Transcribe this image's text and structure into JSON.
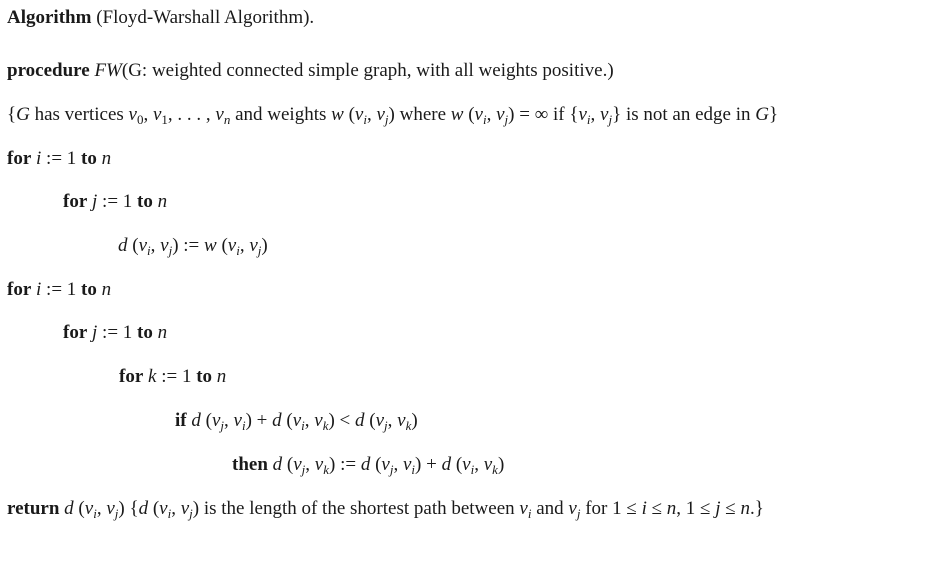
{
  "title": {
    "label": "Algorithm",
    "name": "(Floyd-Warshall Algorithm)."
  },
  "procedure": {
    "keyword": "procedure",
    "name": "FW",
    "params": "(G: weighted connected simple graph, with all weights positive.)"
  },
  "comment_vertices": {
    "open": "{",
    "G": "G",
    "t1": " has vertices ",
    "v": "v",
    "s0": "0",
    "s1": "1",
    "ellipsis": ", . . . , ",
    "sn": "n",
    "t2": " and weights ",
    "w": "w",
    "t3": " where ",
    "infty": " = ∞ if ",
    "t4": " is not an edge in ",
    "close": "}"
  },
  "lines": {
    "for_i_1": {
      "kw": "for",
      "var": "i",
      "assign": " := 1 ",
      "to": "to",
      "end": "n"
    },
    "for_j_1": {
      "kw": "for",
      "var": "j",
      "assign": " := 1 ",
      "to": "to",
      "end": "n"
    },
    "init": {
      "lhs": "d (v",
      "lhs_i": "i",
      "comma": ", v",
      "lhs_j": "j",
      "rp": ")",
      "assign": " := ",
      "rhs": "w (v"
    },
    "for_i_2": {
      "kw": "for",
      "var": "i",
      "assign": " := 1 ",
      "to": "to",
      "end": "n"
    },
    "for_j_2": {
      "kw": "for",
      "var": "j",
      "assign": " := 1 ",
      "to": "to",
      "end": "n"
    },
    "for_k": {
      "kw": "for",
      "var": "k",
      "assign": " := 1 ",
      "to": "to",
      "end": "n"
    },
    "if": {
      "kw": "if",
      "lt": " < ",
      "plus": " + "
    },
    "then": {
      "kw": "then",
      "assign": " := ",
      "plus": " + "
    }
  },
  "return": {
    "kw": "return",
    "desc1": " is the length of the shortest path between ",
    "and": " and ",
    "for": " for 1 ≤ ",
    "le_n": " ≤ ",
    "comma": ", 1 ≤ ",
    "end": ".}"
  }
}
